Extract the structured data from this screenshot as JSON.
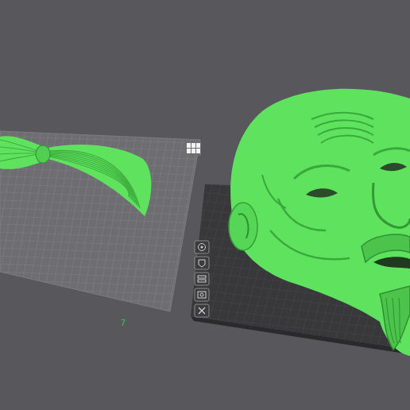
{
  "viewport": {
    "plates": [
      {
        "name": "hair-plate",
        "selected": false
      },
      {
        "name": "head-plate",
        "selected": true
      }
    ],
    "plate_number": "7",
    "model_color": "#5fe35f",
    "plate_tools": [
      {
        "kind": "orient"
      },
      {
        "kind": "lock"
      },
      {
        "kind": "arrange"
      },
      {
        "kind": "settings"
      },
      {
        "kind": "delete"
      }
    ]
  }
}
